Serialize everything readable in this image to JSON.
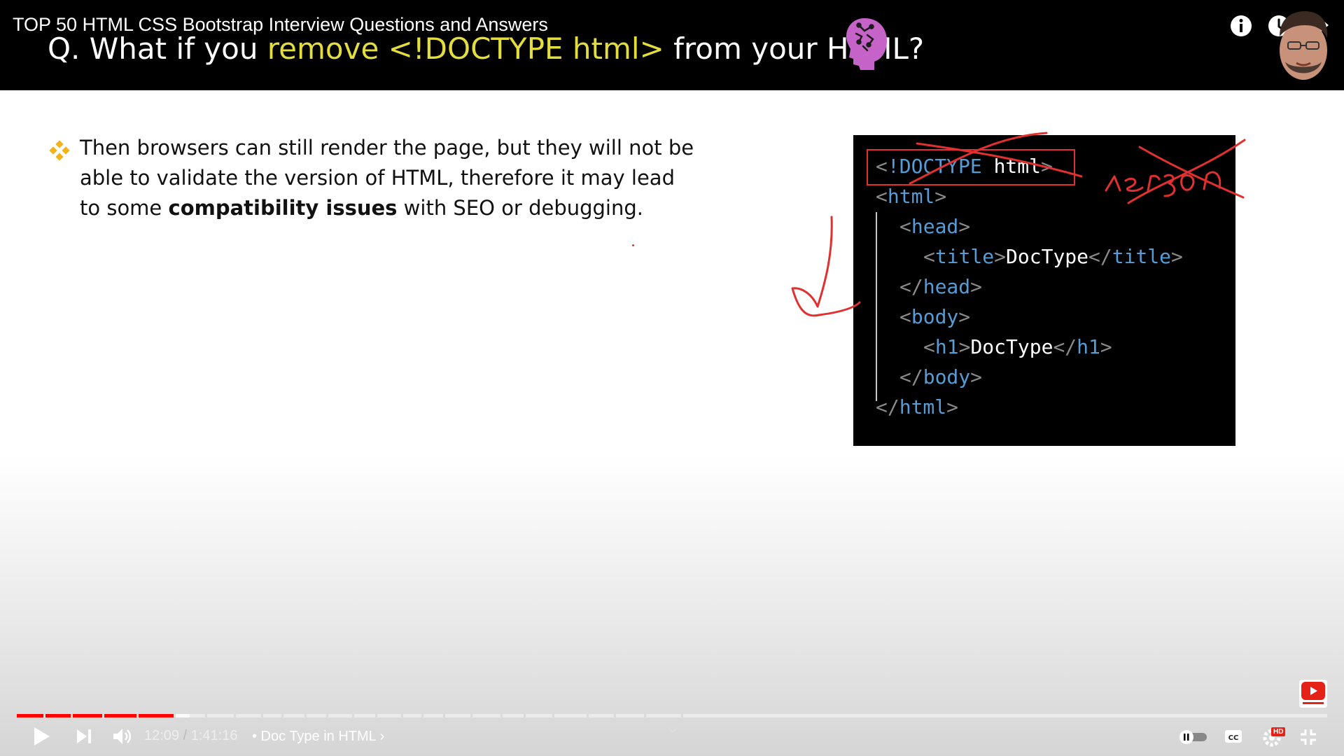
{
  "header": {
    "video_title": "TOP 50 HTML CSS Bootstrap Interview Questions and Answers",
    "question_prefix": "Q. What if you ",
    "question_highlight": "remove <!DOCTYPE html>",
    "question_suffix": " from your HTML?",
    "icons": [
      "brain-icon",
      "info-icon",
      "watch-later-icon",
      "share-icon"
    ]
  },
  "slide": {
    "bullet_part1": "Then browsers can still render the page, but they will not be able to validate the version of HTML, therefore it may lead to some ",
    "bullet_bold": "compatibility issues",
    "bullet_part2": " with SEO or debugging.",
    "code": [
      {
        "open": "<",
        "tag": "!DOCTYPE",
        "text": " html",
        "close": ">"
      },
      {
        "open": "<",
        "tag": "html",
        "close": ">"
      },
      {
        "open": "<",
        "tag": "head",
        "close": ">"
      },
      {
        "open": "<",
        "tag": "title",
        "close": ">",
        "content": "DocType",
        "open2": "</",
        "tag2": "title",
        "close2": ">"
      },
      {
        "open": "</",
        "tag": "head",
        "close": ">"
      },
      {
        "open": "<",
        "tag": "body",
        "close": ">"
      },
      {
        "open": "<",
        "tag": "h1",
        "close": ">",
        "content": "DocType",
        "open2": "</",
        "tag2": "h1",
        "close2": ">"
      },
      {
        "open": "</",
        "tag": "body",
        "close": ">"
      },
      {
        "open": "</",
        "tag": "html",
        "close": ">"
      }
    ],
    "annotation_word": "version"
  },
  "player": {
    "current_time": "12:09",
    "separator": " / ",
    "duration": "1:41:16",
    "chapter_title": "• Doc Type in HTML ›",
    "progress_fraction": 0.12,
    "accent_color": "#ff0000",
    "icons": [
      "play-icon",
      "next-icon",
      "volume-icon",
      "chevron-down-icon",
      "autoplay-toggle-icon",
      "captions-icon",
      "settings-icon",
      "exit-fullscreen-icon",
      "subscribe-icon"
    ],
    "hd_badge": "HD"
  }
}
